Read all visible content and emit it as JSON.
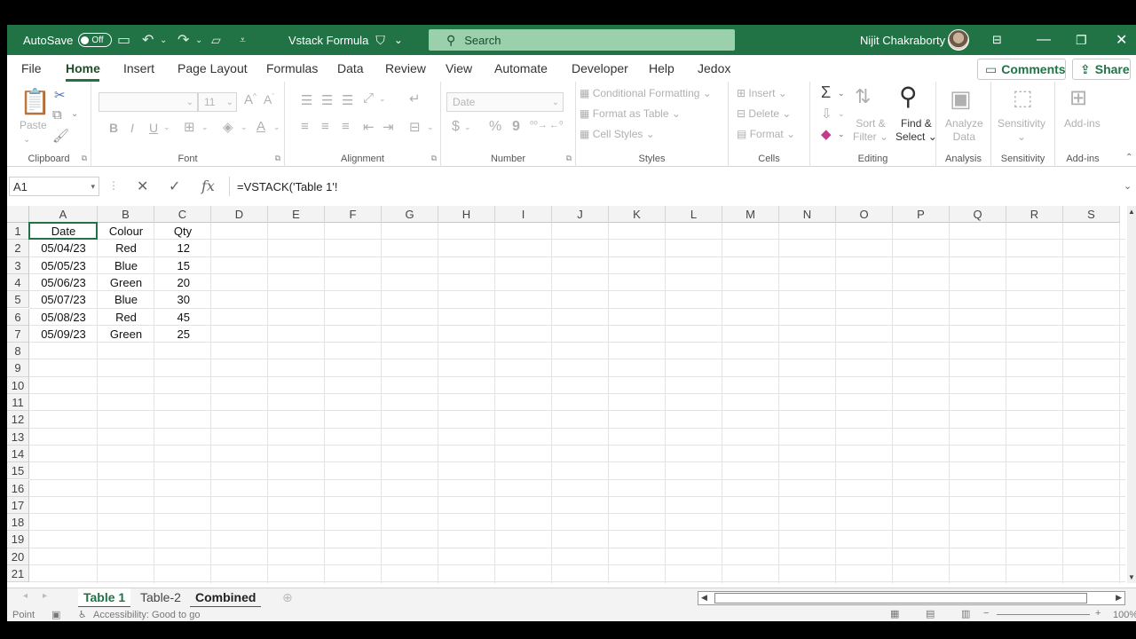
{
  "titlebar": {
    "autosave_label": "AutoSave",
    "autosave_state": "Off",
    "doc_title": "Vstack Formula",
    "search_placeholder": "Search",
    "user_name": "Nijit Chakraborty",
    "accent_color": "#217346"
  },
  "menu": {
    "tabs": [
      "File",
      "Home",
      "Insert",
      "Page Layout",
      "Formulas",
      "Data",
      "Review",
      "View",
      "Automate",
      "Developer",
      "Help",
      "Jedox"
    ],
    "active": "Home",
    "comments_label": "Comments",
    "share_label": "Share"
  },
  "ribbon": {
    "clipboard": {
      "label": "Clipboard",
      "paste": "Paste"
    },
    "font": {
      "label": "Font",
      "size": "11",
      "bold": "B",
      "italic": "I",
      "underline": "U"
    },
    "alignment": {
      "label": "Alignment"
    },
    "number": {
      "label": "Number",
      "format": "Date",
      "currency": "$",
      "percent": "%",
      "comma": "9"
    },
    "styles": {
      "label": "Styles",
      "conditional": "Conditional Formatting",
      "format_table": "Format as Table",
      "cell_styles": "Cell Styles"
    },
    "cells": {
      "label": "Cells",
      "insert": "Insert",
      "delete": "Delete",
      "format": "Format"
    },
    "editing": {
      "label": "Editing",
      "sort_1": "Sort &",
      "sort_2": "Filter",
      "find_1": "Find &",
      "find_2": "Select"
    },
    "analysis": {
      "label": "Analysis",
      "analyze_1": "Analyze",
      "analyze_2": "Data"
    },
    "sensitivity": {
      "label": "Sensitivity",
      "button": "Sensitivity"
    },
    "addins": {
      "label": "Add-ins",
      "button": "Add-ins"
    }
  },
  "formula_bar": {
    "name_box": "A1",
    "formula": "=VSTACK('Table 1'!"
  },
  "grid": {
    "columns": [
      "A",
      "B",
      "C",
      "D",
      "E",
      "F",
      "G",
      "H",
      "I",
      "J",
      "K",
      "L",
      "M",
      "N",
      "O",
      "P",
      "Q",
      "R",
      "S"
    ],
    "rows": [
      "1",
      "2",
      "3",
      "4",
      "5",
      "6",
      "7",
      "8",
      "9",
      "10",
      "11",
      "12",
      "13",
      "14",
      "15",
      "16",
      "17",
      "18",
      "19",
      "20",
      "21"
    ],
    "headers": [
      "Date",
      "Colour",
      "Qty"
    ],
    "data": [
      [
        "05/04/23",
        "Red",
        "12"
      ],
      [
        "05/05/23",
        "Blue",
        "15"
      ],
      [
        "05/06/23",
        "Green",
        "20"
      ],
      [
        "05/07/23",
        "Blue",
        "30"
      ],
      [
        "05/08/23",
        "Red",
        "45"
      ],
      [
        "05/09/23",
        "Green",
        "25"
      ]
    ]
  },
  "sheets": {
    "tabs": [
      "Table 1",
      "Table-2",
      "Combined"
    ],
    "active": "Table 1"
  },
  "status": {
    "mode": "Point",
    "accessibility": "Accessibility: Good to go",
    "zoom": "100%"
  }
}
